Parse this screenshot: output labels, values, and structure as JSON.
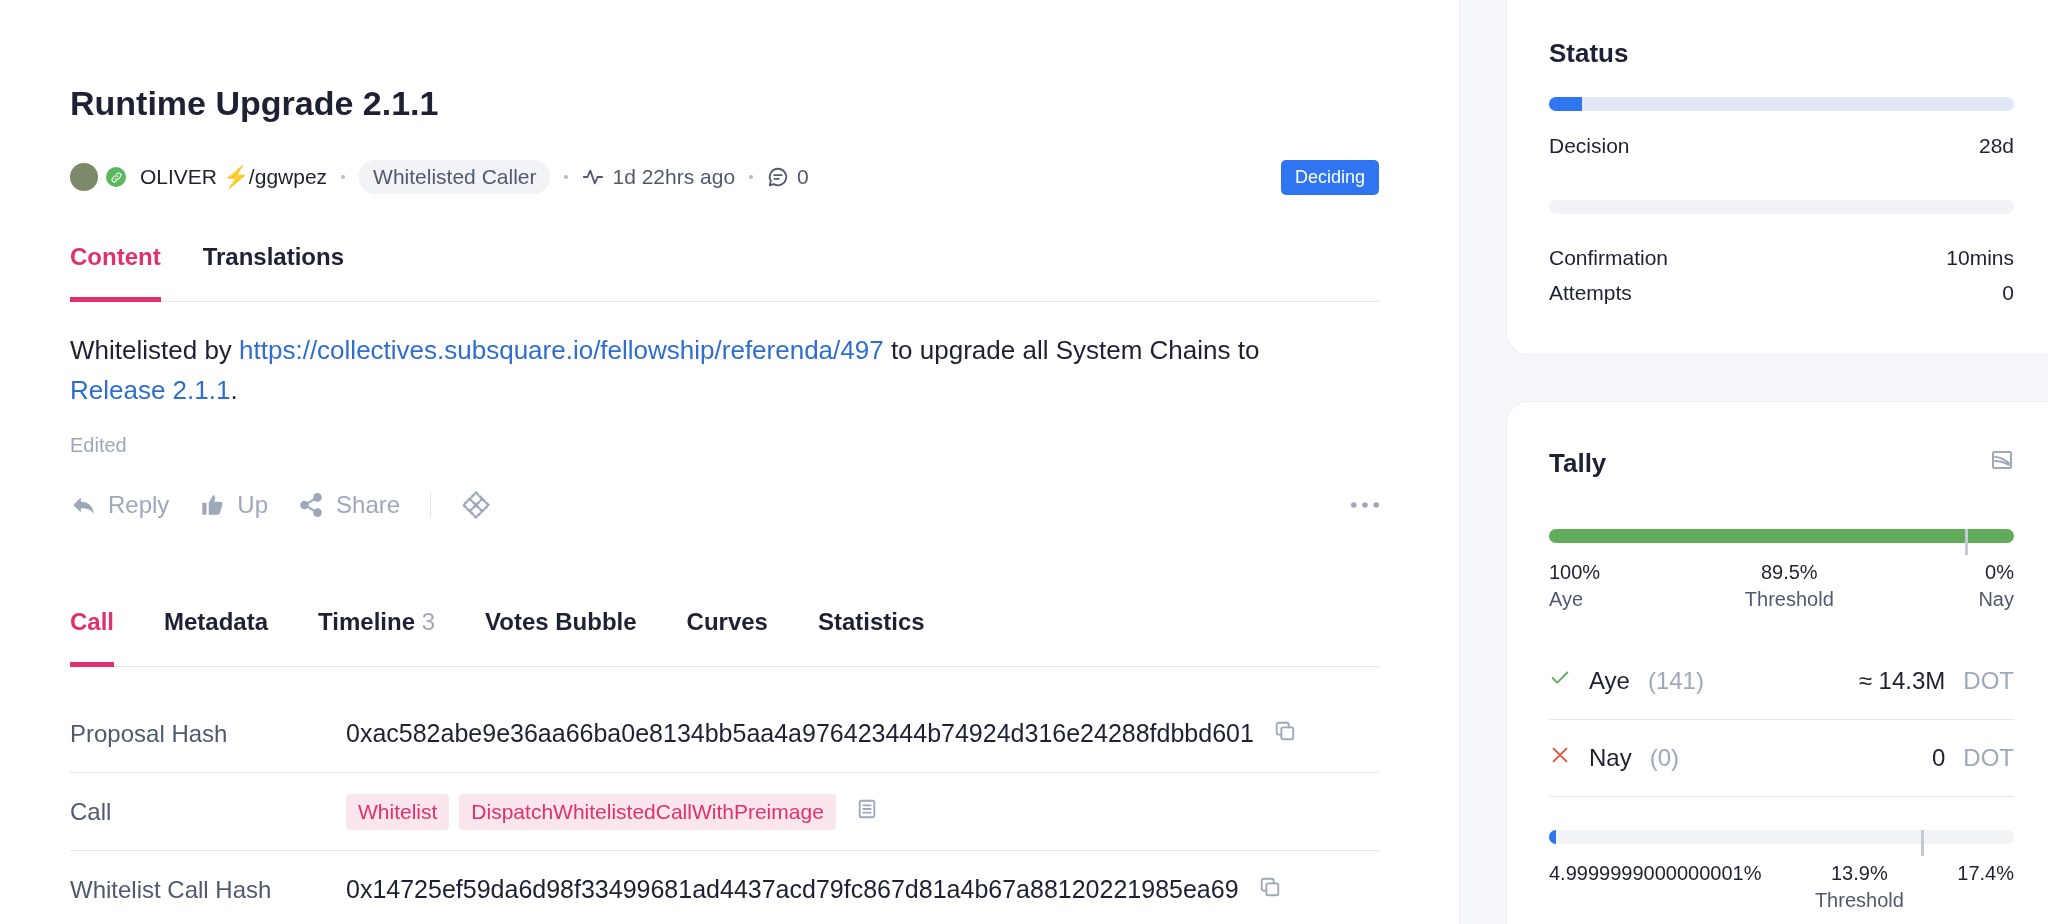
{
  "title": "Runtime Upgrade 2.1.1",
  "meta": {
    "author": "OLIVER ⚡/ggwpez",
    "role": "Whitelisted Caller",
    "time": "1d 22hrs ago",
    "comments": "0",
    "status": "Deciding"
  },
  "content_tabs": [
    {
      "label": "Content",
      "selected": true
    },
    {
      "label": "Translations",
      "selected": false
    }
  ],
  "body": [
    {
      "kind": "text",
      "text": "Whitelisted by "
    },
    {
      "kind": "link",
      "text": "https://collectives.subsquare.io/fellowship/referenda/497"
    },
    {
      "kind": "text",
      "text": " to upgrade all System Chains to "
    },
    {
      "kind": "link",
      "text": "Release 2.1.1"
    },
    {
      "kind": "text",
      "text": "."
    }
  ],
  "edited": "Edited",
  "actions": [
    {
      "kind": "reply",
      "label": "Reply"
    },
    {
      "kind": "up",
      "label": "Up"
    },
    {
      "kind": "share",
      "label": "Share"
    }
  ],
  "detail_tabs": [
    {
      "label": "Call",
      "selected": true
    },
    {
      "label": "Metadata",
      "selected": false
    },
    {
      "label": "Timeline",
      "count": "3",
      "selected": false
    },
    {
      "label": "Votes Bubble",
      "selected": false
    },
    {
      "label": "Curves",
      "selected": false
    },
    {
      "label": "Statistics",
      "selected": false
    }
  ],
  "rows": [
    {
      "label": "Proposal Hash",
      "kind": "hash",
      "value": "0xac582abe9e36aa66ba0e8134bb5aa4a976423444b74924d316e24288fdbbd601"
    },
    {
      "label": "Call",
      "kind": "tags",
      "tags": [
        "Whitelist",
        "DispatchWhitelistedCallWithPreimage"
      ]
    },
    {
      "label": "Whitelist Call Hash",
      "kind": "hash",
      "value": "0x14725ef59da6d98f33499681ad4437acd79fc867d81a4b67a88120221985ea69"
    }
  ],
  "status": {
    "title": "Status",
    "phases": [
      {
        "level": 0.07,
        "rows": [
          {
            "label": "Decision",
            "value": "28d"
          }
        ]
      },
      {
        "rows": [
          {
            "label": "Confirmation",
            "value": "10mins"
          },
          {
            "label": "Attempts",
            "value": "0"
          }
        ]
      }
    ]
  },
  "tally": {
    "title": "Tally",
    "approval": {
      "level": 1,
      "threshold": {
        "level": 0.895
      },
      "labels": [
        {
          "value": "100%",
          "caption": "Aye"
        },
        {
          "value": "89.5%",
          "caption": "Threshold"
        },
        {
          "value": "0%",
          "caption": "Nay"
        }
      ]
    },
    "votes": [
      {
        "kind": "aye",
        "label": "Aye",
        "count": "(141)",
        "amount": "≈ 14.3M",
        "unit": "DOT"
      },
      {
        "kind": "nay",
        "label": "Nay",
        "count": "(0)",
        "amount": "0",
        "unit": "DOT"
      }
    ],
    "support": {
      "level": 0.015,
      "threshold": {
        "level": 0.8
      },
      "labels": [
        {
          "value": "4.9999999000000001%"
        },
        {
          "value": "13.9%",
          "caption": "Threshold"
        },
        {
          "value": "17.4%"
        }
      ]
    }
  }
}
